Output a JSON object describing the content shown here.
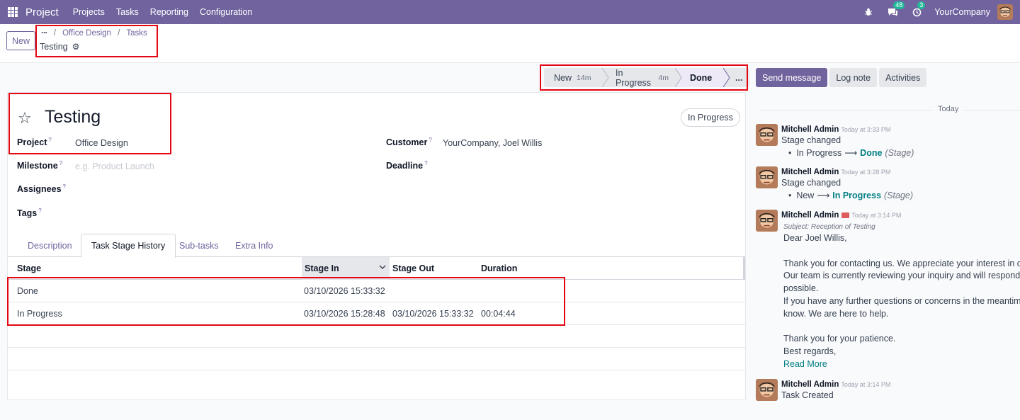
{
  "navbar": {
    "brand": "Project",
    "menu": [
      "Projects",
      "Tasks",
      "Reporting",
      "Configuration"
    ],
    "messages_badge": "48",
    "activities_badge": "3",
    "company": "YourCompany"
  },
  "control_panel": {
    "new_label": "New",
    "breadcrumb_dots": "···",
    "breadcrumb": [
      "Office Design",
      "Tasks"
    ],
    "record_name": "Testing"
  },
  "statusbar": {
    "stages": [
      {
        "label": "New",
        "duration": "14m"
      },
      {
        "label": "In Progress",
        "duration": "4m"
      },
      {
        "label": "Done",
        "duration": ""
      }
    ],
    "more": "..."
  },
  "chatter_buttons": {
    "send": "Send message",
    "log": "Log note",
    "activities": "Activities"
  },
  "form": {
    "title": "Testing",
    "state": "In Progress",
    "fields": {
      "project_label": "Project",
      "project_value": "Office Design",
      "milestone_label": "Milestone",
      "milestone_placeholder": "e.g. Product Launch",
      "assignees_label": "Assignees",
      "tags_label": "Tags",
      "customer_label": "Customer",
      "customer_value": "YourCompany, Joel Willis",
      "deadline_label": "Deadline",
      "help_mark": "?"
    },
    "tabs": [
      "Description",
      "Task Stage History",
      "Sub-tasks",
      "Extra Info"
    ],
    "history": {
      "columns": [
        "Stage",
        "Stage In",
        "Stage Out",
        "Duration"
      ],
      "rows": [
        {
          "stage": "Done",
          "in": "03/10/2026 15:33:32",
          "out": "",
          "duration": ""
        },
        {
          "stage": "In Progress",
          "in": "03/10/2026 15:28:48",
          "out": "03/10/2026 15:33:32",
          "duration": "00:04:44"
        }
      ]
    }
  },
  "chatter": {
    "today": "Today",
    "messages": [
      {
        "author": "Mitchell Admin",
        "time": "Today at 3:33 PM",
        "text": "Stage changed",
        "old": "In Progress",
        "new": "Done",
        "field": "(Stage)"
      },
      {
        "author": "Mitchell Admin",
        "time": "Today at 3:28 PM",
        "text": "Stage changed",
        "old": "New",
        "new": "In Progress",
        "field": "(Stage)"
      },
      {
        "author": "Mitchell Admin",
        "time": "Today at 3:14 PM",
        "subject": "Subject: Reception of Testing",
        "body": [
          "Dear Joel Willis,",
          "",
          "Thank you for contacting us. We appreciate your interest in our",
          "Our team is currently reviewing your inquiry and will respond to",
          "possible.",
          "If you have any further questions or concerns in the meantime,",
          "know. We are here to help.",
          "",
          "Thank you for your patience.",
          "Best regards,"
        ],
        "read_more": "Read More"
      },
      {
        "author": "Mitchell Admin",
        "time": "Today at 3:14 PM",
        "text": "Task Created"
      }
    ]
  }
}
